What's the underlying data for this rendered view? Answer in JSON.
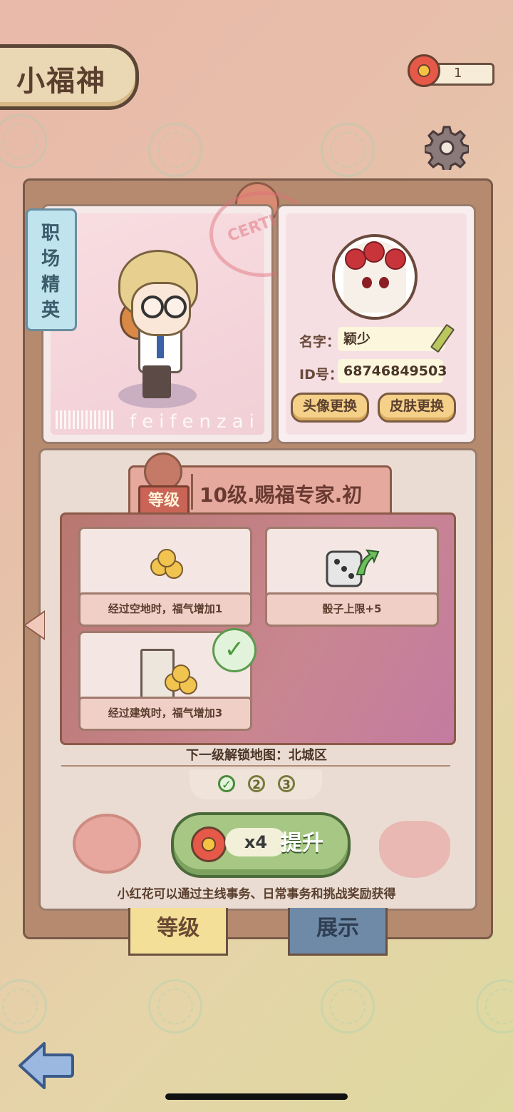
{
  "header": {
    "title": "小福神",
    "flower_count": "1"
  },
  "profile": {
    "job_tag": [
      "职",
      "场",
      "精",
      "英"
    ],
    "stamp_text": "CERTIFIC",
    "watermark": "feifenzai",
    "name_label": "名字：",
    "name_value": "颖少",
    "id_label": "ID号：",
    "id_value": "68746849503",
    "avatar_button": "头像更换",
    "skin_button": "皮肤更换"
  },
  "level": {
    "badge": "等级",
    "title": "10级.赐福专家.初",
    "perks": [
      {
        "text": "经过空地时，福气增加1",
        "icon": "coin-plate-icon"
      },
      {
        "text": "骰子上限+5",
        "icon": "dice-up-icon"
      },
      {
        "text": "经过建筑时，福气增加3",
        "icon": "building-coins-icon",
        "unlocked": true
      }
    ],
    "next_unlock": "下一级解锁地图：北城区",
    "steps": [
      "✓",
      "2",
      "3"
    ],
    "upgrade_cost": "x4",
    "upgrade_label": "提升",
    "hint": "小红花可以通过主线事务、日常事务和挑战奖励获得"
  },
  "tabs": {
    "level": "等级",
    "showcase": "展示"
  },
  "colors": {
    "accent_green": "#a7c884",
    "flower_red": "#e65948"
  }
}
